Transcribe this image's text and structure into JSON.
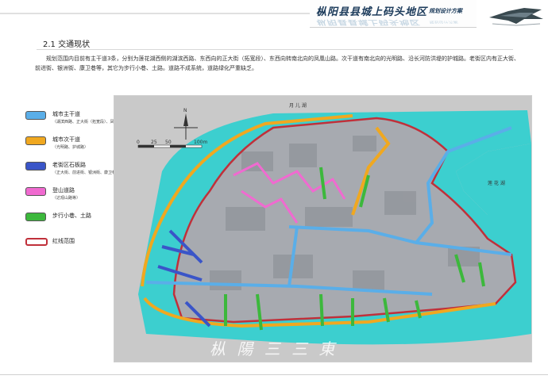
{
  "header": {
    "title": "枞阳县县城上码头地区",
    "subtitle": "规划设计方案"
  },
  "section": {
    "title": "2.1  交通现状",
    "paragraph": "规划范围内目前有主干道3条，分别为莲花湖西侧的湖滨西路、东西向的正大街（拓宽段）、东西向转南北向的凤凰山路。次干道有南北向的光明路、沿长河防洪堤的护城路。老街区内有正大街、前进街、银洲街、康卫巷等，其它为步行小巷、土路。道路不成系统，道路绿化严重缺乏。"
  },
  "legend": {
    "items": [
      {
        "label": "城市主干道",
        "note": "（湖滨西路、正大街（拓宽段）、凤凰山路）",
        "color": "#5aaee8"
      },
      {
        "label": "城市次干道",
        "note": "（光明路、护城路）",
        "color": "#f0a820"
      },
      {
        "label": "老街区石板路",
        "note": "（正大街、前进街、银洲街、康卫巷等）",
        "color": "#3a55c8"
      },
      {
        "label": "登山道路",
        "note": "（达观山路等）",
        "color": "#f06ad0"
      },
      {
        "label": "步行小巷、土路",
        "note": "",
        "color": "#3cb83c"
      },
      {
        "label": "红线范围",
        "note": "",
        "color": "#ffffff"
      }
    ]
  },
  "map": {
    "lake_north_label": "月 儿 湖",
    "lake_east_label": "莲 花 湖",
    "compass_label": "N",
    "scale_labels": [
      "0",
      "25",
      "50",
      "100m"
    ],
    "watermark": "枞 陽 三 三 東",
    "colors": {
      "water": "#3ccfcf",
      "urban": "#a7aab0",
      "redline": "#c0303a"
    }
  }
}
